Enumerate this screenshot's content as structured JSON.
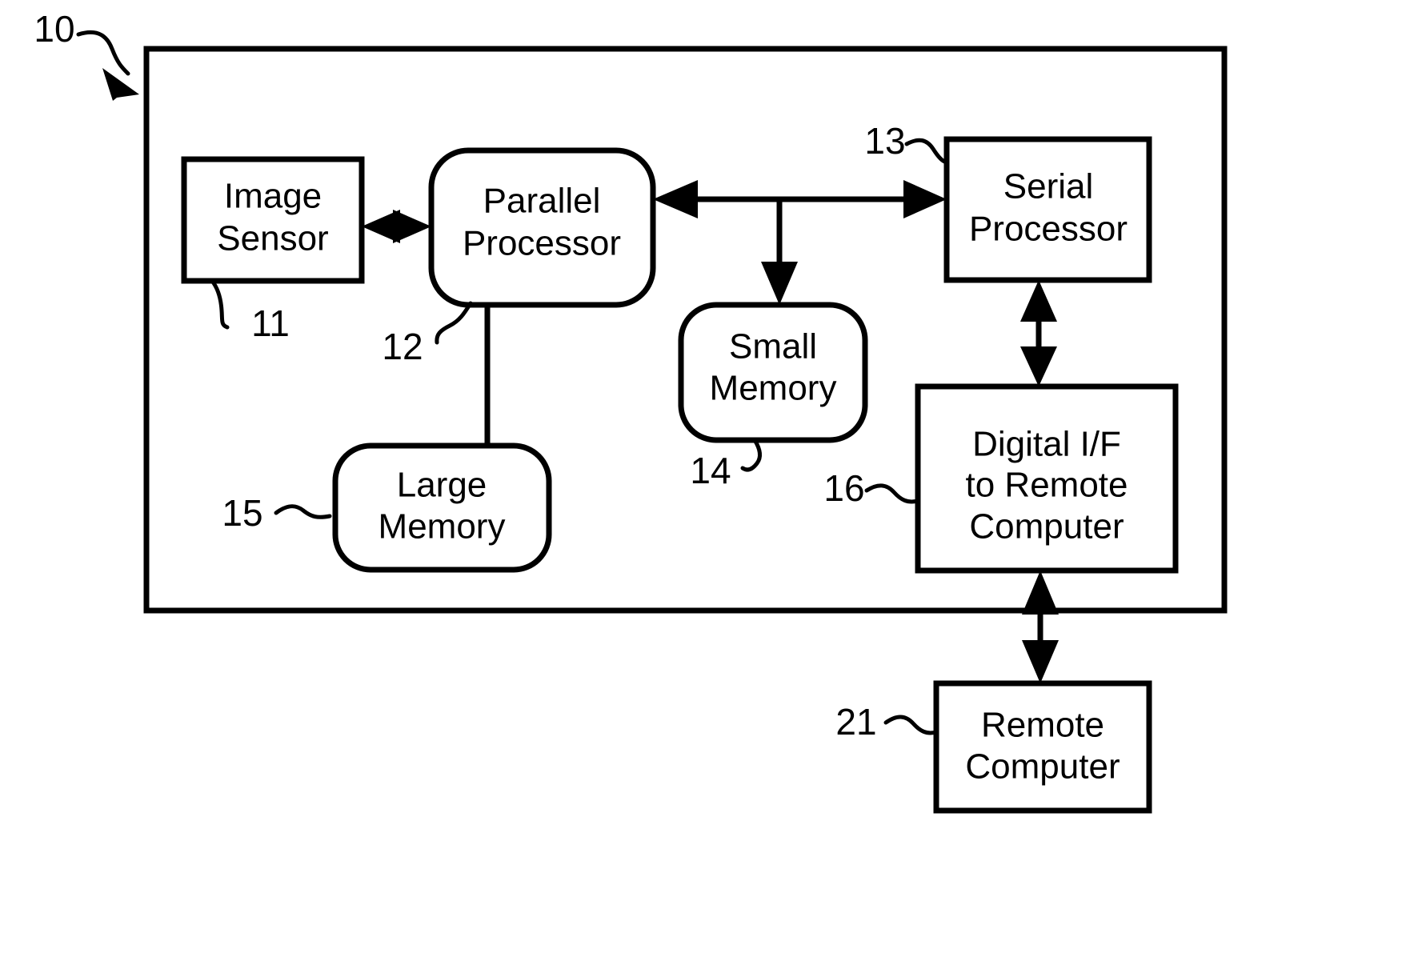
{
  "figure": {
    "title": "Imaging system block diagram",
    "line_color": "#000000",
    "background_color": "#ffffff"
  },
  "system_boundary": {
    "ref": "10",
    "name": "system-enclosure"
  },
  "blocks": [
    {
      "id": "image-sensor",
      "ref": "11",
      "shape": "rect",
      "lines": [
        "Image",
        "Sensor"
      ]
    },
    {
      "id": "parallel-processor",
      "ref": "12",
      "shape": "rounded-rect",
      "lines": [
        "Parallel",
        "Processor"
      ]
    },
    {
      "id": "serial-processor",
      "ref": "13",
      "shape": "rect",
      "lines": [
        "Serial",
        "Processor"
      ]
    },
    {
      "id": "small-memory",
      "ref": "14",
      "shape": "rounded-rect",
      "lines": [
        "Small",
        "Memory"
      ]
    },
    {
      "id": "large-memory",
      "ref": "15",
      "shape": "rounded-rect",
      "lines": [
        "Large",
        "Memory"
      ]
    },
    {
      "id": "digital-if",
      "ref": "16",
      "shape": "rect",
      "lines": [
        "Digital I/F",
        "to Remote",
        "Computer"
      ]
    },
    {
      "id": "remote-computer",
      "ref": "21",
      "shape": "rect",
      "lines": [
        "Remote",
        "Computer"
      ]
    }
  ],
  "connections": [
    {
      "id": "sensor-to-parallel",
      "from": "image-sensor",
      "to": "parallel-processor",
      "arrows": "both"
    },
    {
      "id": "parallel-to-serial",
      "from": "parallel-processor",
      "to": "serial-processor",
      "arrows": "both"
    },
    {
      "id": "bus-to-small-memory",
      "from": "parallel-serial-bus",
      "to": "small-memory",
      "arrows": "to"
    },
    {
      "id": "parallel-to-large-memory",
      "from": "parallel-processor",
      "to": "large-memory",
      "arrows": "none"
    },
    {
      "id": "serial-to-digital-if",
      "from": "serial-processor",
      "to": "digital-if",
      "arrows": "both"
    },
    {
      "id": "digital-if-to-remote",
      "from": "digital-if",
      "to": "remote-computer",
      "arrows": "both"
    }
  ],
  "text": {
    "image_sensor_l1": "Image",
    "image_sensor_l2": "Sensor",
    "parallel_processor_l1": "Parallel",
    "parallel_processor_l2": "Processor",
    "serial_processor_l1": "Serial",
    "serial_processor_l2": "Processor",
    "small_memory_l1": "Small",
    "small_memory_l2": "Memory",
    "large_memory_l1": "Large",
    "large_memory_l2": "Memory",
    "digital_if_l1": "Digital I/F",
    "digital_if_l2": "to Remote",
    "digital_if_l3": "Computer",
    "remote_computer_l1": "Remote",
    "remote_computer_l2": "Computer"
  },
  "refs": {
    "system": "10",
    "image_sensor": "11",
    "parallel_processor": "12",
    "serial_processor": "13",
    "small_memory": "14",
    "large_memory": "15",
    "digital_if": "16",
    "remote_computer": "21"
  }
}
